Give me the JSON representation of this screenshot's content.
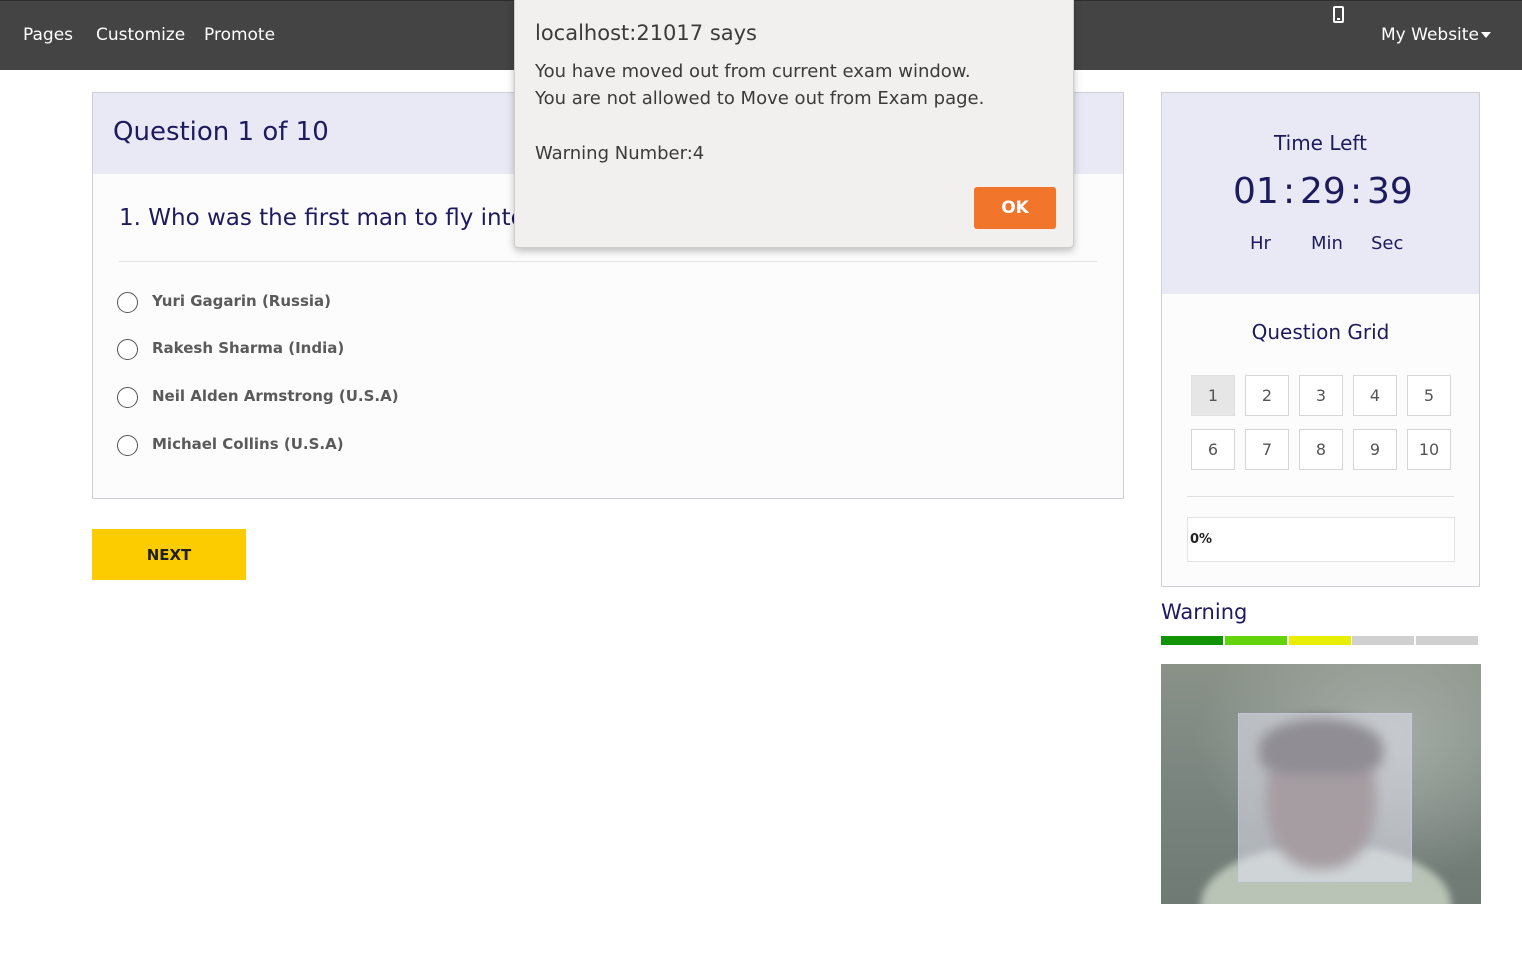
{
  "nav": {
    "links": [
      "Pages",
      "Customize",
      "Promote"
    ],
    "device_icon": "mobile-phone-icon",
    "site_menu_label": "My Website"
  },
  "question": {
    "header": "Question 1 of 10",
    "text": "1. Who was the first man to fly into s",
    "options": [
      "Yuri Gagarin (Russia)",
      "Rakesh Sharma (India)",
      "Neil Alden Armstrong (U.S.A)",
      "Michael Collins (U.S.A)"
    ],
    "selected_option": null
  },
  "next_button": "NEXT",
  "timer": {
    "title": "Time Left",
    "hours": "01",
    "minutes": "29",
    "seconds": "39",
    "separator": ":",
    "labels": {
      "hours": "Hr",
      "minutes": "Min",
      "seconds": "Sec"
    }
  },
  "question_grid": {
    "title": "Question Grid",
    "numbers": [
      "1",
      "2",
      "3",
      "4",
      "5",
      "6",
      "7",
      "8",
      "9",
      "10"
    ],
    "current": "1"
  },
  "progress": {
    "label": "0%",
    "value": 0
  },
  "warning": {
    "title": "Warning",
    "level": 3,
    "max_level": 5,
    "segment_colors": [
      "#119304",
      "#63d40b",
      "#e7ee00",
      "#d0d0d0",
      "#d0d0d0"
    ]
  },
  "dialog": {
    "title": "localhost:21017 says",
    "line1": "You have moved out from current exam window.",
    "line2": "You are not allowed to Move out from Exam page.",
    "line3": "Warning Number:4",
    "ok_label": "OK"
  },
  "colors": {
    "navbar": "#444444",
    "header_bg": "#e9e9f5",
    "heading_text": "#1d1a5e",
    "next_button": "#fccc00",
    "ok_button": "#f1762c"
  }
}
